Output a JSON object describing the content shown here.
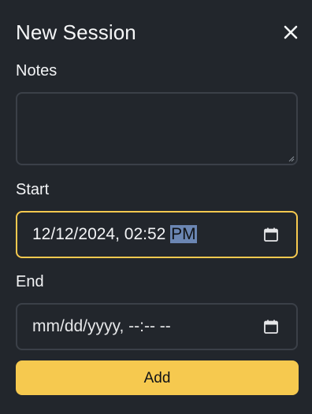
{
  "dialog": {
    "title": "New Session",
    "close_icon": "close-icon"
  },
  "notes": {
    "label": "Notes",
    "value": ""
  },
  "start": {
    "label": "Start",
    "value_main": "12/12/2024, 02:52 ",
    "value_selected": "PM",
    "icon": "calendar-icon"
  },
  "end": {
    "label": "End",
    "placeholder": "mm/dd/yyyy, --:-- --",
    "icon": "calendar-icon"
  },
  "add_button": {
    "label": "Add"
  },
  "colors": {
    "background": "#22262c",
    "border": "#3b4048",
    "accent": "#f6c94f",
    "selection": "#6b86b3"
  }
}
